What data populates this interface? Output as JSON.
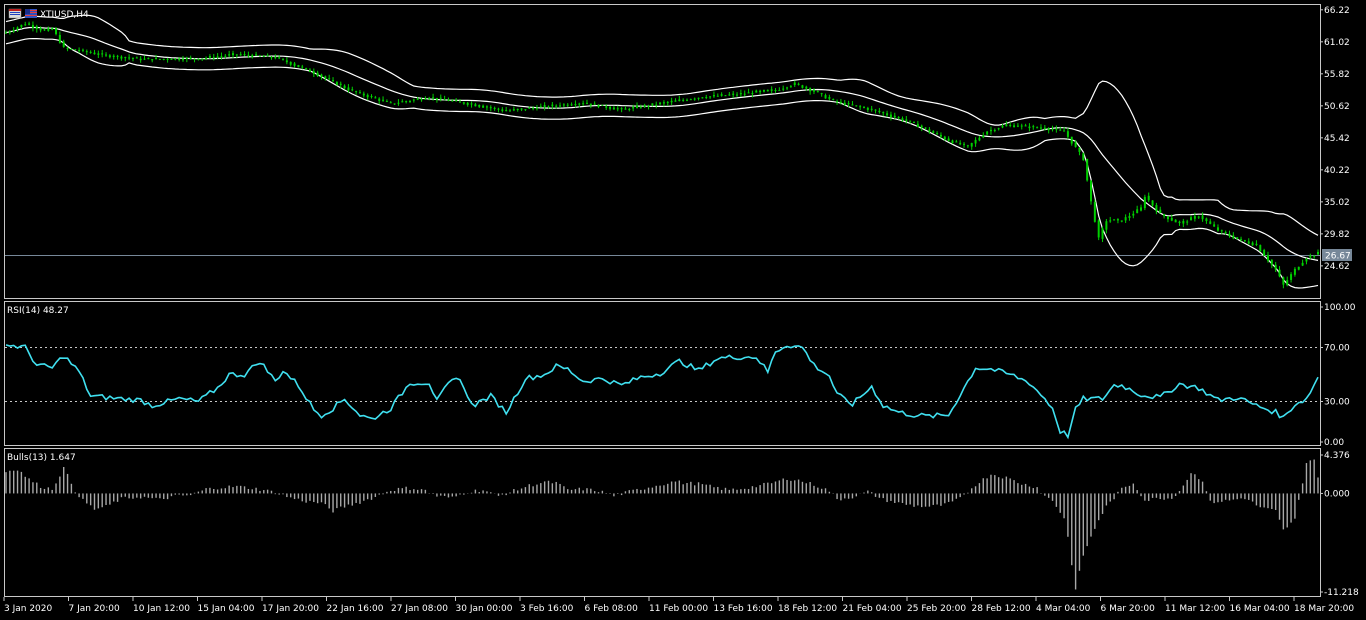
{
  "window": {
    "symbol_title": "XTIUSD,H4"
  },
  "colors": {
    "background": "#000000",
    "frame": "#c8c8c8",
    "candle": "#00d000",
    "bands": "#ffffff",
    "rsi": "#40e0f0",
    "bulls": "#a8a8a8",
    "price_line": "#778899",
    "price_tag_bg": "#778899"
  },
  "x_axis": {
    "labels": [
      "3 Jan 2020",
      "7 Jan 20:00",
      "10 Jan 12:00",
      "15 Jan 04:00",
      "17 Jan 20:00",
      "22 Jan 16:00",
      "27 Jan 08:00",
      "30 Jan 00:00",
      "3 Feb 16:00",
      "6 Feb 08:00",
      "11 Feb 00:00",
      "13 Feb 16:00",
      "18 Feb 12:00",
      "21 Feb 04:00",
      "25 Feb 20:00",
      "28 Feb 12:00",
      "4 Mar 04:00",
      "6 Mar 20:00",
      "11 Mar 12:00",
      "16 Mar 04:00",
      "18 Mar 20:00"
    ]
  },
  "chart_data": [
    {
      "type": "candlestick",
      "title": "XTIUSD,H4",
      "indicator": "Bollinger Bands",
      "y_ticks": [
        "66.22",
        "61.02",
        "55.82",
        "50.62",
        "45.42",
        "40.22",
        "35.02",
        "29.82",
        "24.62"
      ],
      "ylim": [
        19.4,
        67.0
      ],
      "current_price": "26.67",
      "close_anchors": [
        [
          0,
          62.5
        ],
        [
          5,
          64
        ],
        [
          10,
          62.8
        ],
        [
          12,
          63.2
        ],
        [
          15,
          60
        ],
        [
          20,
          59.5
        ],
        [
          25,
          58.9
        ],
        [
          35,
          58.2
        ],
        [
          50,
          58.3
        ],
        [
          60,
          59
        ],
        [
          70,
          58.5
        ],
        [
          80,
          56
        ],
        [
          90,
          53
        ],
        [
          100,
          51
        ],
        [
          110,
          52
        ],
        [
          120,
          51
        ],
        [
          130,
          49.8
        ],
        [
          140,
          50.5
        ],
        [
          150,
          51.1
        ],
        [
          160,
          50
        ],
        [
          170,
          51
        ],
        [
          180,
          52
        ],
        [
          190,
          52.5
        ],
        [
          200,
          53.2
        ],
        [
          205,
          54.2
        ],
        [
          210,
          53
        ],
        [
          215,
          51.4
        ],
        [
          225,
          50
        ],
        [
          235,
          48
        ],
        [
          245,
          45
        ],
        [
          250,
          44
        ],
        [
          255,
          46.5
        ],
        [
          260,
          47.5
        ],
        [
          270,
          47
        ],
        [
          275,
          46.5
        ],
        [
          280,
          42
        ],
        [
          282,
          35
        ],
        [
          284,
          29
        ],
        [
          286,
          32
        ],
        [
          290,
          32
        ],
        [
          295,
          34
        ],
        [
          296,
          36
        ],
        [
          300,
          33
        ],
        [
          305,
          31.5
        ],
        [
          310,
          32.8
        ],
        [
          315,
          30.4
        ],
        [
          320,
          29
        ],
        [
          325,
          28
        ],
        [
          330,
          24
        ],
        [
          332,
          21.5
        ],
        [
          335,
          24
        ],
        [
          338,
          26
        ],
        [
          341,
          26.67
        ]
      ]
    },
    {
      "type": "line",
      "title": "RSI(14) 48.27",
      "y_ticks": [
        "100.00",
        "70.00",
        "30.00",
        "0.00"
      ],
      "ylim": [
        0,
        100
      ],
      "levels": [
        70,
        30
      ],
      "anchors": [
        [
          0,
          72
        ],
        [
          5,
          70
        ],
        [
          8,
          57
        ],
        [
          12,
          55
        ],
        [
          15,
          64
        ],
        [
          19,
          52
        ],
        [
          22,
          34
        ],
        [
          30,
          32
        ],
        [
          35,
          31
        ],
        [
          38,
          27
        ],
        [
          45,
          32
        ],
        [
          50,
          30
        ],
        [
          55,
          40
        ],
        [
          58,
          50
        ],
        [
          62,
          50
        ],
        [
          66,
          60
        ],
        [
          70,
          45
        ],
        [
          72,
          53
        ],
        [
          76,
          42
        ],
        [
          80,
          24
        ],
        [
          82,
          20
        ],
        [
          85,
          25
        ],
        [
          88,
          32
        ],
        [
          92,
          20
        ],
        [
          95,
          17
        ],
        [
          100,
          25
        ],
        [
          105,
          44
        ],
        [
          110,
          44
        ],
        [
          112,
          30
        ],
        [
          115,
          43
        ],
        [
          118,
          48
        ],
        [
          120,
          32
        ],
        [
          122,
          28
        ],
        [
          126,
          34
        ],
        [
          130,
          22
        ],
        [
          135,
          47
        ],
        [
          140,
          50
        ],
        [
          143,
          56
        ],
        [
          146,
          54
        ],
        [
          150,
          45
        ],
        [
          155,
          47
        ],
        [
          160,
          42
        ],
        [
          165,
          48
        ],
        [
          170,
          51
        ],
        [
          175,
          60
        ],
        [
          180,
          53
        ],
        [
          185,
          62
        ],
        [
          190,
          63
        ],
        [
          195,
          63
        ],
        [
          198,
          52
        ],
        [
          200,
          67
        ],
        [
          203,
          72
        ],
        [
          207,
          70
        ],
        [
          210,
          57
        ],
        [
          214,
          49
        ],
        [
          216,
          35
        ],
        [
          220,
          28
        ],
        [
          225,
          41
        ],
        [
          228,
          27
        ],
        [
          232,
          22
        ],
        [
          236,
          20
        ],
        [
          240,
          19
        ],
        [
          245,
          20
        ],
        [
          248,
          35
        ],
        [
          252,
          55
        ],
        [
          256,
          54
        ],
        [
          262,
          49
        ],
        [
          266,
          44
        ],
        [
          270,
          32
        ],
        [
          272,
          25
        ],
        [
          274,
          8
        ],
        [
          276,
          5
        ],
        [
          278,
          24
        ],
        [
          280,
          32
        ],
        [
          285,
          32
        ],
        [
          288,
          42
        ],
        [
          290,
          42
        ],
        [
          295,
          35
        ],
        [
          300,
          33
        ],
        [
          305,
          43
        ],
        [
          310,
          40
        ],
        [
          315,
          31
        ],
        [
          320,
          33
        ],
        [
          325,
          27
        ],
        [
          330,
          22
        ],
        [
          332,
          18
        ],
        [
          335,
          28
        ],
        [
          338,
          32
        ],
        [
          341,
          48
        ]
      ]
    },
    {
      "type": "bar",
      "title": "Bulls(13) 1.647",
      "y_ticks": [
        "4.376",
        "0.000",
        "-11.218"
      ],
      "ylim": [
        -11.218,
        4.376
      ],
      "anchors": [
        [
          0,
          2.5
        ],
        [
          3,
          2.8
        ],
        [
          6,
          1.6
        ],
        [
          9,
          0.8
        ],
        [
          12,
          0.5
        ],
        [
          15,
          2.9
        ],
        [
          18,
          0.3
        ],
        [
          20,
          -0.8
        ],
        [
          23,
          -1.8
        ],
        [
          26,
          -1.5
        ],
        [
          30,
          -0.6
        ],
        [
          35,
          -0.4
        ],
        [
          40,
          -0.7
        ],
        [
          44,
          -0.3
        ],
        [
          48,
          -0.2
        ],
        [
          52,
          0.5
        ],
        [
          56,
          0.7
        ],
        [
          60,
          0.8
        ],
        [
          64,
          0.6
        ],
        [
          67,
          0.4
        ],
        [
          70,
          0.1
        ],
        [
          74,
          -0.5
        ],
        [
          78,
          -0.9
        ],
        [
          82,
          -1.1
        ],
        [
          85,
          -2.0
        ],
        [
          88,
          -1.5
        ],
        [
          92,
          -1.0
        ],
        [
          96,
          -0.4
        ],
        [
          100,
          0.4
        ],
        [
          104,
          0.6
        ],
        [
          108,
          0.5
        ],
        [
          112,
          -0.3
        ],
        [
          116,
          -0.5
        ],
        [
          120,
          0.2
        ],
        [
          124,
          0.4
        ],
        [
          128,
          -0.3
        ],
        [
          132,
          0.3
        ],
        [
          136,
          0.9
        ],
        [
          140,
          1.3
        ],
        [
          143,
          1.2
        ],
        [
          146,
          0.4
        ],
        [
          150,
          0.5
        ],
        [
          154,
          0.3
        ],
        [
          158,
          -0.3
        ],
        [
          162,
          0.2
        ],
        [
          166,
          0.6
        ],
        [
          170,
          1.0
        ],
        [
          174,
          1.4
        ],
        [
          176,
          1.2
        ],
        [
          180,
          1.1
        ],
        [
          184,
          0.7
        ],
        [
          188,
          0.4
        ],
        [
          192,
          0.6
        ],
        [
          196,
          0.9
        ],
        [
          200,
          1.3
        ],
        [
          203,
          1.7
        ],
        [
          206,
          1.5
        ],
        [
          210,
          1.0
        ],
        [
          214,
          0.3
        ],
        [
          216,
          -0.7
        ],
        [
          220,
          -0.4
        ],
        [
          224,
          0.2
        ],
        [
          228,
          -0.7
        ],
        [
          232,
          -1.1
        ],
        [
          236,
          -1.4
        ],
        [
          240,
          -1.5
        ],
        [
          244,
          -1.3
        ],
        [
          248,
          -0.6
        ],
        [
          252,
          1.0
        ],
        [
          256,
          2.2
        ],
        [
          260,
          1.8
        ],
        [
          264,
          1.1
        ],
        [
          268,
          0.7
        ],
        [
          270,
          -0.3
        ],
        [
          272,
          -0.8
        ],
        [
          275,
          -2.8
        ],
        [
          276,
          -5.0
        ],
        [
          277,
          -8.0
        ],
        [
          278,
          -11.0
        ],
        [
          280,
          -7.0
        ],
        [
          282,
          -5.0
        ],
        [
          284,
          -3.0
        ],
        [
          286,
          -1.5
        ],
        [
          290,
          0.5
        ],
        [
          293,
          1.2
        ],
        [
          296,
          -0.8
        ],
        [
          300,
          -0.5
        ],
        [
          303,
          -0.6
        ],
        [
          306,
          0.9
        ],
        [
          308,
          2.4
        ],
        [
          311,
          1.5
        ],
        [
          313,
          -1.0
        ],
        [
          318,
          -0.8
        ],
        [
          322,
          -0.5
        ],
        [
          326,
          -1.6
        ],
        [
          330,
          -2.0
        ],
        [
          332,
          -4.2
        ],
        [
          335,
          -3.0
        ],
        [
          338,
          3.5
        ],
        [
          340,
          4.0
        ],
        [
          341,
          1.65
        ]
      ]
    }
  ]
}
